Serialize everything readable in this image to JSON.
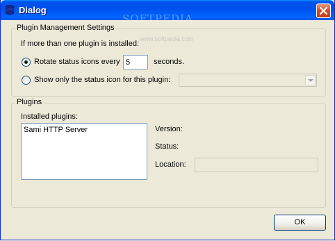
{
  "window": {
    "title": "Dialog",
    "watermark": "SOFTPEDIA",
    "watermark_sub": "www.softpedia.com"
  },
  "plugin_management": {
    "legend": "Plugin Management Settings",
    "intro": "If more than one plugin is installed:",
    "rotate_label": "Rotate status icons every",
    "rotate_value": "5",
    "seconds_label": "seconds.",
    "show_only_label": "Show only the status icon for this plugin:",
    "selected_option": "rotate",
    "plugin_select_value": ""
  },
  "plugins": {
    "legend": "Plugins",
    "installed_label": "Installed plugins:",
    "items": [
      "Sami HTTP Server"
    ],
    "version_label": "Version:",
    "status_label": "Status:",
    "location_label": "Location:",
    "location_value": ""
  },
  "buttons": {
    "ok": "OK"
  }
}
